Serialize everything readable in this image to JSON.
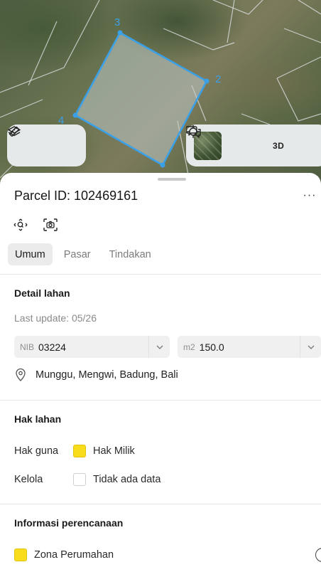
{
  "map": {
    "vertex_labels": [
      "3",
      "2",
      "4"
    ],
    "accent": "#3aa0e8",
    "controls": {
      "layers_icon": "layers-icon",
      "measure_icon": "measure-ruler-icon",
      "basemap_icon": "satellite-thumbnail",
      "locate_icon": "crosshair-icon",
      "threed_label": "3D",
      "compare_icon": "chat-compare-icon"
    }
  },
  "header": {
    "title": "Parcel ID: 102469161",
    "more_label": "···"
  },
  "tabs": [
    {
      "label": "Umum",
      "active": true
    },
    {
      "label": "Pasar",
      "active": false
    },
    {
      "label": "Tindakan",
      "active": false
    }
  ],
  "detail": {
    "title": "Detail lahan",
    "last_update": "Last update: 05/26",
    "nib_prefix": "NIB",
    "nib_value": "03224",
    "area_prefix": "m2",
    "area_value": "150.0",
    "address": "Munggu, Mengwi, Badung, Bali"
  },
  "rights": {
    "title": "Hak lahan",
    "rows": [
      {
        "key": "Hak guna",
        "value": "Hak Milik",
        "swatch": "#f9dc1c"
      },
      {
        "key": "Kelola",
        "value": "Tidak ada data",
        "swatch": "#ffffff"
      }
    ]
  },
  "planning": {
    "title": "Informasi perencanaan",
    "zone": "Zona Perumahan",
    "zone_color": "#f9dc1c"
  }
}
